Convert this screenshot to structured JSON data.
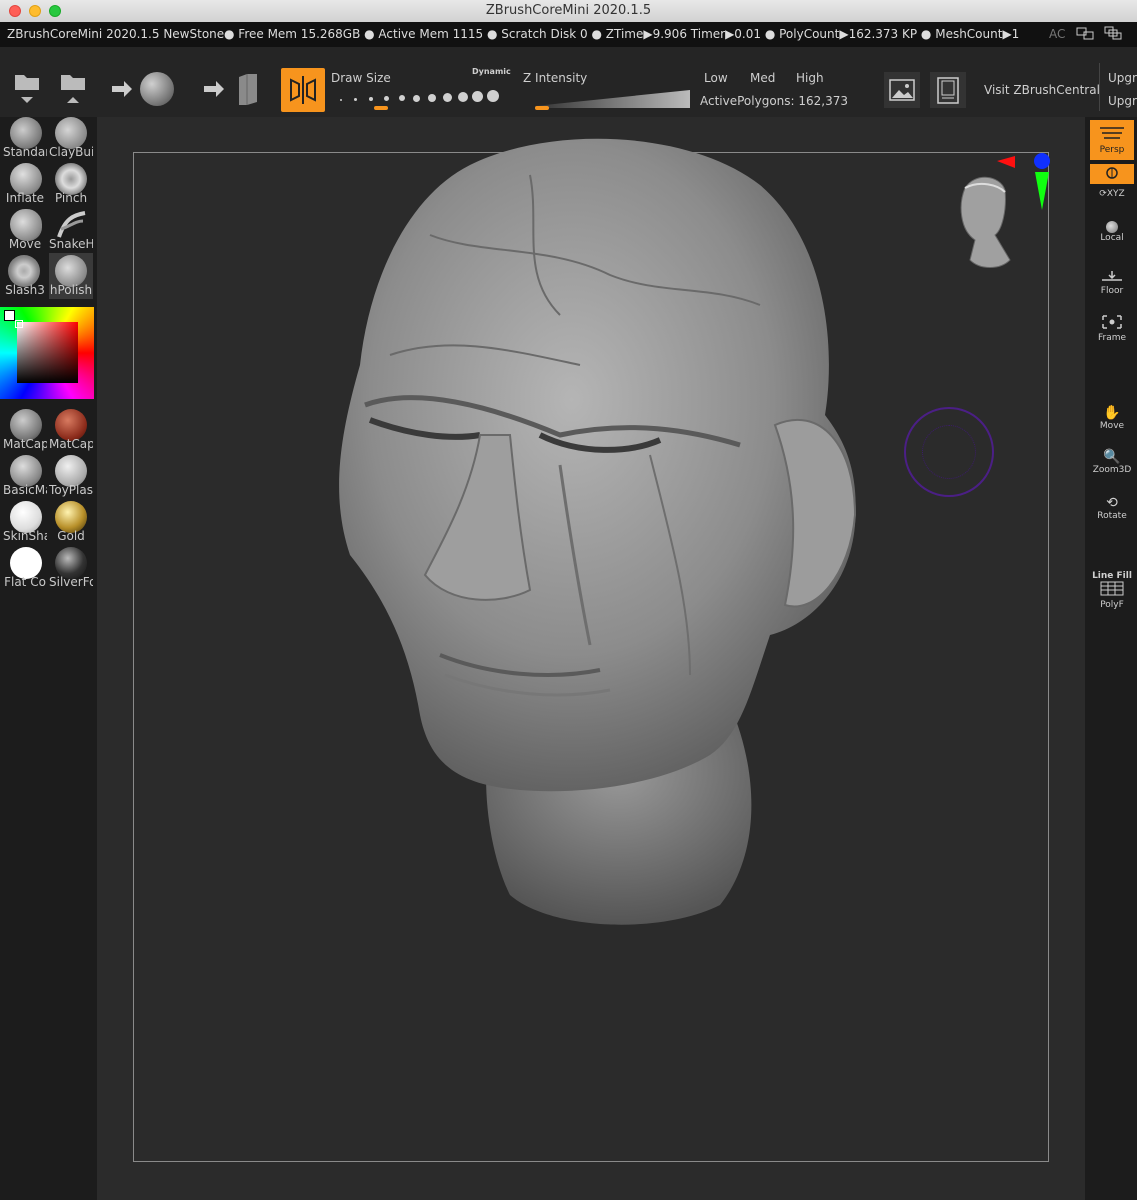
{
  "window": {
    "title": "ZBrushCoreMini 2020.1.5"
  },
  "status": {
    "app": "ZBrushCoreMini 2020.1.5 NewStone",
    "free_mem": "● Free Mem 15.268GB ● Active Mem 1115 ● Scratch Disk 0 ● ZTime▶9.906 Timer▶0.01 ● PolyCount▶162.373 KP ● MeshCount▶1",
    "ac": "AC"
  },
  "toolbar": {
    "draw_size_label": "Draw Size",
    "dynamic_label": "Dynamic",
    "z_intensity_label": "Z Intensity",
    "low": "Low",
    "med": "Med",
    "high": "High",
    "active_polygons": "ActivePolygons: 162,373",
    "visit": "Visit ZBrushCentral",
    "upgrade1": "Upgr",
    "upgrade2": "Upgr"
  },
  "brushes": [
    {
      "label": "Standar"
    },
    {
      "label": "ClayBui"
    },
    {
      "label": "Inflate"
    },
    {
      "label": "Pinch"
    },
    {
      "label": "Move"
    },
    {
      "label": "SnakeH"
    },
    {
      "label": "Slash3"
    },
    {
      "label": "hPolish"
    }
  ],
  "materials": [
    {
      "label": "MatCap"
    },
    {
      "label": "MatCap"
    },
    {
      "label": "BasicMa"
    },
    {
      "label": "ToyPlas"
    },
    {
      "label": "SkinSha"
    },
    {
      "label": "Gold"
    },
    {
      "label": "Flat Co"
    },
    {
      "label": "SilverFo"
    }
  ],
  "right": {
    "persp": "Persp",
    "xyz": "XYZ",
    "local": "Local",
    "floor": "Floor",
    "frame": "Frame",
    "move": "Move",
    "zoom3d": "Zoom3D",
    "rotate": "Rotate",
    "line_fill": "Line Fill",
    "polyf": "PolyF"
  },
  "colors": {
    "accent": "#f7941d",
    "canvas": "#2b2b2b",
    "shelf": "#1c1c1c"
  }
}
